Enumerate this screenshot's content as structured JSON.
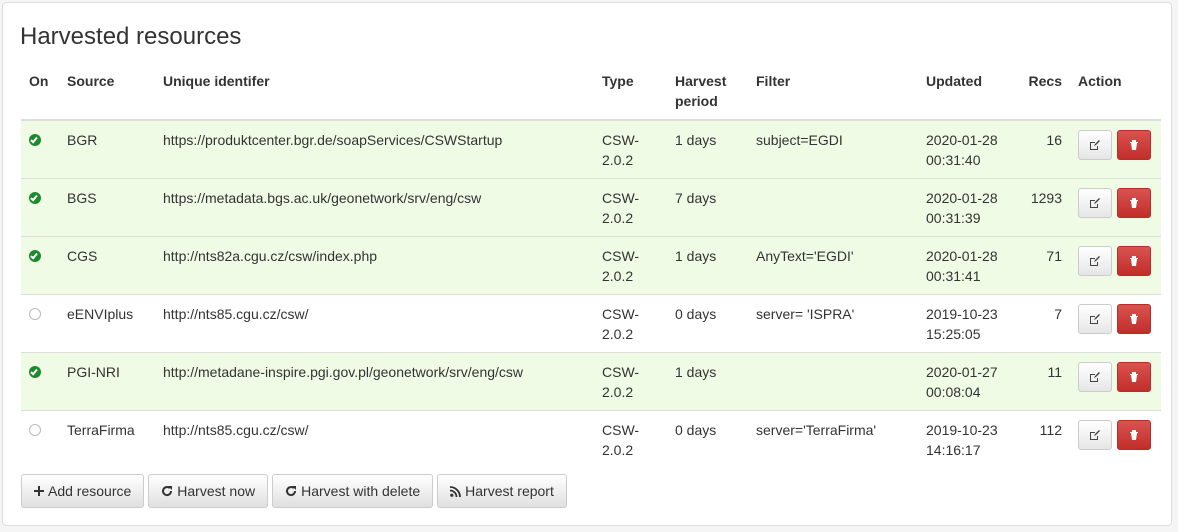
{
  "title": "Harvested resources",
  "columns": {
    "on": "On",
    "source": "Source",
    "uid": "Unique identifer",
    "type": "Type",
    "period1": "Harvest",
    "period2": "period",
    "filter": "Filter",
    "updated": "Updated",
    "recs": "Recs",
    "action": "Action"
  },
  "rows": [
    {
      "on": true,
      "source": "BGR",
      "uid": "https://produktcenter.bgr.de/soapServices/CSWStartup",
      "type1": "CSW-",
      "type2": "2.0.2",
      "period": "1 days",
      "filter": "subject=EGDI",
      "date": "2020-01-28",
      "time": "00:31:40",
      "recs": "16"
    },
    {
      "on": true,
      "source": "BGS",
      "uid": "https://metadata.bgs.ac.uk/geonetwork/srv/eng/csw",
      "type1": "CSW-",
      "type2": "2.0.2",
      "period": "7 days",
      "filter": "",
      "date": "2020-01-28",
      "time": "00:31:39",
      "recs": "1293"
    },
    {
      "on": true,
      "source": "CGS",
      "uid": "http://nts82a.cgu.cz/csw/index.php",
      "type1": "CSW-",
      "type2": "2.0.2",
      "period": "1 days",
      "filter": "AnyText='EGDI'",
      "date": "2020-01-28",
      "time": "00:31:41",
      "recs": "71"
    },
    {
      "on": false,
      "source": "eENVIplus",
      "uid": "http://nts85.cgu.cz/csw/",
      "type1": "CSW-",
      "type2": "2.0.2",
      "period": "0 days",
      "filter": "server= 'ISPRA'",
      "date": "2019-10-23",
      "time": "15:25:05",
      "recs": "7"
    },
    {
      "on": true,
      "source": "PGI-NRI",
      "uid": "http://metadane-inspire.pgi.gov.pl/geonetwork/srv/eng/csw",
      "type1": "CSW-",
      "type2": "2.0.2",
      "period": "1 days",
      "filter": "",
      "date": "2020-01-27",
      "time": "00:08:04",
      "recs": "11"
    },
    {
      "on": false,
      "source": "TerraFirma",
      "uid": "http://nts85.cgu.cz/csw/",
      "type1": "CSW-",
      "type2": "2.0.2",
      "period": "0 days",
      "filter": "server='TerraFirma'",
      "date": "2019-10-23",
      "time": "14:16:17",
      "recs": "112"
    }
  ],
  "row_actions": {
    "edit_icon": "edit-icon",
    "delete_icon": "trash-icon"
  },
  "toolbar": {
    "add": "Add resource",
    "harvest": "Harvest now",
    "harvest_delete": "Harvest with delete",
    "report": "Harvest report"
  },
  "colors": {
    "on_row": "#effbe5",
    "on_icon": "#1e8a2e",
    "delete": "#d9534f"
  }
}
